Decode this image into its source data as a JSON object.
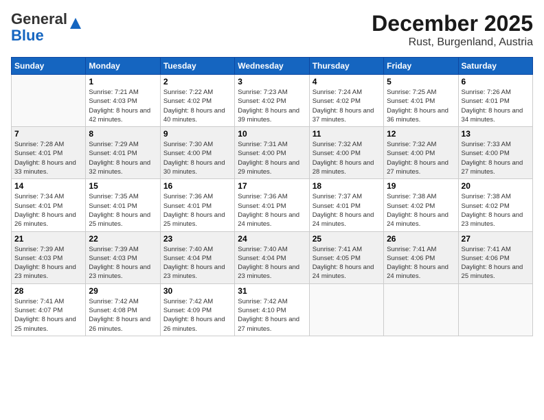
{
  "logo": {
    "general": "General",
    "blue": "Blue"
  },
  "title": "December 2025",
  "subtitle": "Rust, Burgenland, Austria",
  "days_of_week": [
    "Sunday",
    "Monday",
    "Tuesday",
    "Wednesday",
    "Thursday",
    "Friday",
    "Saturday"
  ],
  "weeks": [
    [
      {
        "day": "",
        "sunrise": "",
        "sunset": "",
        "daylight": ""
      },
      {
        "day": "1",
        "sunrise": "Sunrise: 7:21 AM",
        "sunset": "Sunset: 4:03 PM",
        "daylight": "Daylight: 8 hours and 42 minutes."
      },
      {
        "day": "2",
        "sunrise": "Sunrise: 7:22 AM",
        "sunset": "Sunset: 4:02 PM",
        "daylight": "Daylight: 8 hours and 40 minutes."
      },
      {
        "day": "3",
        "sunrise": "Sunrise: 7:23 AM",
        "sunset": "Sunset: 4:02 PM",
        "daylight": "Daylight: 8 hours and 39 minutes."
      },
      {
        "day": "4",
        "sunrise": "Sunrise: 7:24 AM",
        "sunset": "Sunset: 4:02 PM",
        "daylight": "Daylight: 8 hours and 37 minutes."
      },
      {
        "day": "5",
        "sunrise": "Sunrise: 7:25 AM",
        "sunset": "Sunset: 4:01 PM",
        "daylight": "Daylight: 8 hours and 36 minutes."
      },
      {
        "day": "6",
        "sunrise": "Sunrise: 7:26 AM",
        "sunset": "Sunset: 4:01 PM",
        "daylight": "Daylight: 8 hours and 34 minutes."
      }
    ],
    [
      {
        "day": "7",
        "sunrise": "Sunrise: 7:28 AM",
        "sunset": "Sunset: 4:01 PM",
        "daylight": "Daylight: 8 hours and 33 minutes."
      },
      {
        "day": "8",
        "sunrise": "Sunrise: 7:29 AM",
        "sunset": "Sunset: 4:01 PM",
        "daylight": "Daylight: 8 hours and 32 minutes."
      },
      {
        "day": "9",
        "sunrise": "Sunrise: 7:30 AM",
        "sunset": "Sunset: 4:00 PM",
        "daylight": "Daylight: 8 hours and 30 minutes."
      },
      {
        "day": "10",
        "sunrise": "Sunrise: 7:31 AM",
        "sunset": "Sunset: 4:00 PM",
        "daylight": "Daylight: 8 hours and 29 minutes."
      },
      {
        "day": "11",
        "sunrise": "Sunrise: 7:32 AM",
        "sunset": "Sunset: 4:00 PM",
        "daylight": "Daylight: 8 hours and 28 minutes."
      },
      {
        "day": "12",
        "sunrise": "Sunrise: 7:32 AM",
        "sunset": "Sunset: 4:00 PM",
        "daylight": "Daylight: 8 hours and 27 minutes."
      },
      {
        "day": "13",
        "sunrise": "Sunrise: 7:33 AM",
        "sunset": "Sunset: 4:00 PM",
        "daylight": "Daylight: 8 hours and 27 minutes."
      }
    ],
    [
      {
        "day": "14",
        "sunrise": "Sunrise: 7:34 AM",
        "sunset": "Sunset: 4:01 PM",
        "daylight": "Daylight: 8 hours and 26 minutes."
      },
      {
        "day": "15",
        "sunrise": "Sunrise: 7:35 AM",
        "sunset": "Sunset: 4:01 PM",
        "daylight": "Daylight: 8 hours and 25 minutes."
      },
      {
        "day": "16",
        "sunrise": "Sunrise: 7:36 AM",
        "sunset": "Sunset: 4:01 PM",
        "daylight": "Daylight: 8 hours and 25 minutes."
      },
      {
        "day": "17",
        "sunrise": "Sunrise: 7:36 AM",
        "sunset": "Sunset: 4:01 PM",
        "daylight": "Daylight: 8 hours and 24 minutes."
      },
      {
        "day": "18",
        "sunrise": "Sunrise: 7:37 AM",
        "sunset": "Sunset: 4:01 PM",
        "daylight": "Daylight: 8 hours and 24 minutes."
      },
      {
        "day": "19",
        "sunrise": "Sunrise: 7:38 AM",
        "sunset": "Sunset: 4:02 PM",
        "daylight": "Daylight: 8 hours and 24 minutes."
      },
      {
        "day": "20",
        "sunrise": "Sunrise: 7:38 AM",
        "sunset": "Sunset: 4:02 PM",
        "daylight": "Daylight: 8 hours and 23 minutes."
      }
    ],
    [
      {
        "day": "21",
        "sunrise": "Sunrise: 7:39 AM",
        "sunset": "Sunset: 4:03 PM",
        "daylight": "Daylight: 8 hours and 23 minutes."
      },
      {
        "day": "22",
        "sunrise": "Sunrise: 7:39 AM",
        "sunset": "Sunset: 4:03 PM",
        "daylight": "Daylight: 8 hours and 23 minutes."
      },
      {
        "day": "23",
        "sunrise": "Sunrise: 7:40 AM",
        "sunset": "Sunset: 4:04 PM",
        "daylight": "Daylight: 8 hours and 23 minutes."
      },
      {
        "day": "24",
        "sunrise": "Sunrise: 7:40 AM",
        "sunset": "Sunset: 4:04 PM",
        "daylight": "Daylight: 8 hours and 23 minutes."
      },
      {
        "day": "25",
        "sunrise": "Sunrise: 7:41 AM",
        "sunset": "Sunset: 4:05 PM",
        "daylight": "Daylight: 8 hours and 24 minutes."
      },
      {
        "day": "26",
        "sunrise": "Sunrise: 7:41 AM",
        "sunset": "Sunset: 4:06 PM",
        "daylight": "Daylight: 8 hours and 24 minutes."
      },
      {
        "day": "27",
        "sunrise": "Sunrise: 7:41 AM",
        "sunset": "Sunset: 4:06 PM",
        "daylight": "Daylight: 8 hours and 25 minutes."
      }
    ],
    [
      {
        "day": "28",
        "sunrise": "Sunrise: 7:41 AM",
        "sunset": "Sunset: 4:07 PM",
        "daylight": "Daylight: 8 hours and 25 minutes."
      },
      {
        "day": "29",
        "sunrise": "Sunrise: 7:42 AM",
        "sunset": "Sunset: 4:08 PM",
        "daylight": "Daylight: 8 hours and 26 minutes."
      },
      {
        "day": "30",
        "sunrise": "Sunrise: 7:42 AM",
        "sunset": "Sunset: 4:09 PM",
        "daylight": "Daylight: 8 hours and 26 minutes."
      },
      {
        "day": "31",
        "sunrise": "Sunrise: 7:42 AM",
        "sunset": "Sunset: 4:10 PM",
        "daylight": "Daylight: 8 hours and 27 minutes."
      },
      {
        "day": "",
        "sunrise": "",
        "sunset": "",
        "daylight": ""
      },
      {
        "day": "",
        "sunrise": "",
        "sunset": "",
        "daylight": ""
      },
      {
        "day": "",
        "sunrise": "",
        "sunset": "",
        "daylight": ""
      }
    ]
  ]
}
